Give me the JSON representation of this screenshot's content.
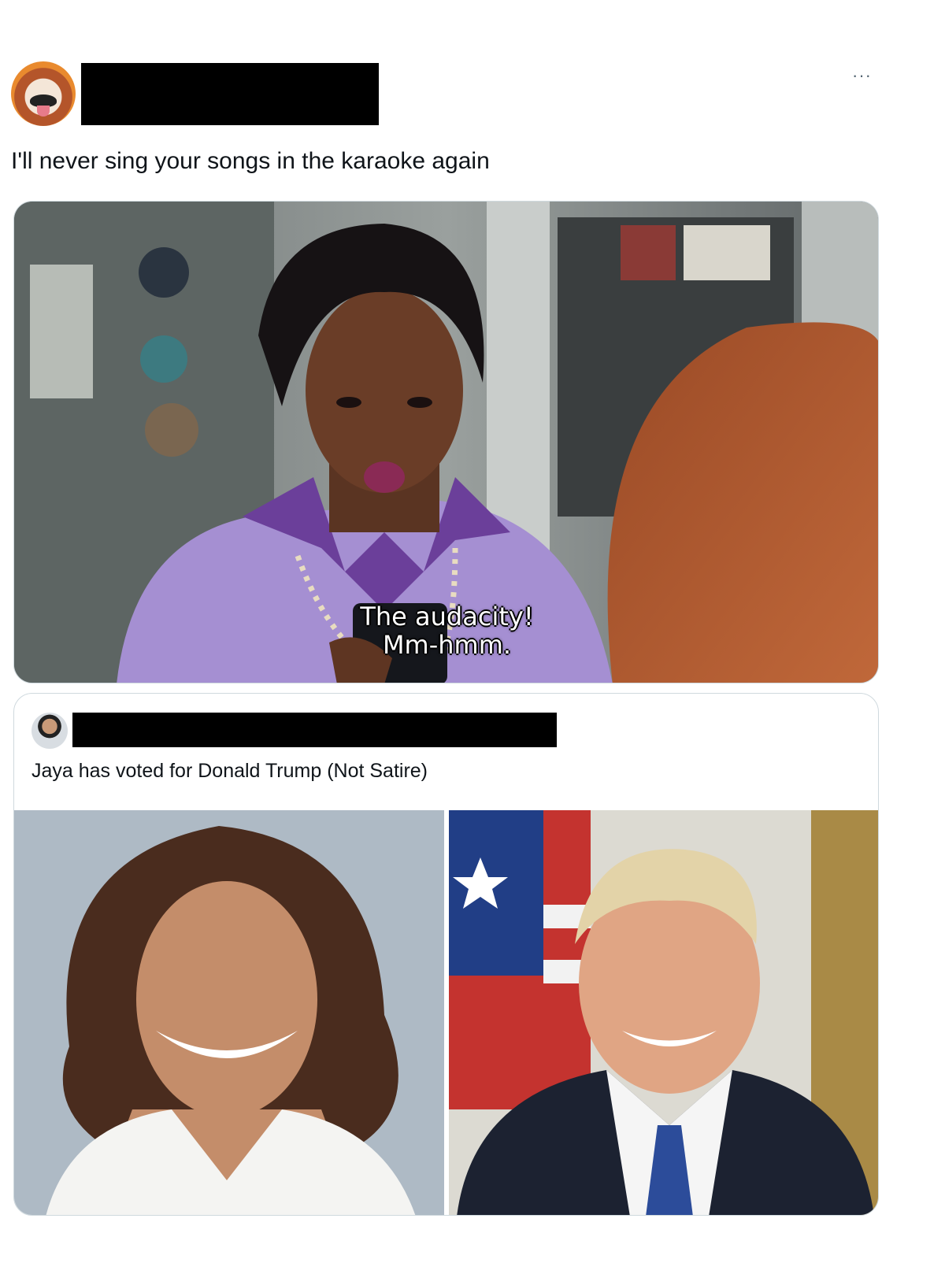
{
  "tweet": {
    "text": "I'll never sing your songs in the karaoke again",
    "more_label": "···",
    "media": {
      "subtitle_line1": "The audacity!",
      "subtitle_line2": "Mm-hmm."
    }
  },
  "quote": {
    "text": "Jaya has voted for Donald Trump (Not Satire)"
  },
  "colors": {
    "text": "#0f1419",
    "secondary": "#536471",
    "border": "#cfd9de",
    "redaction": "#000000"
  }
}
